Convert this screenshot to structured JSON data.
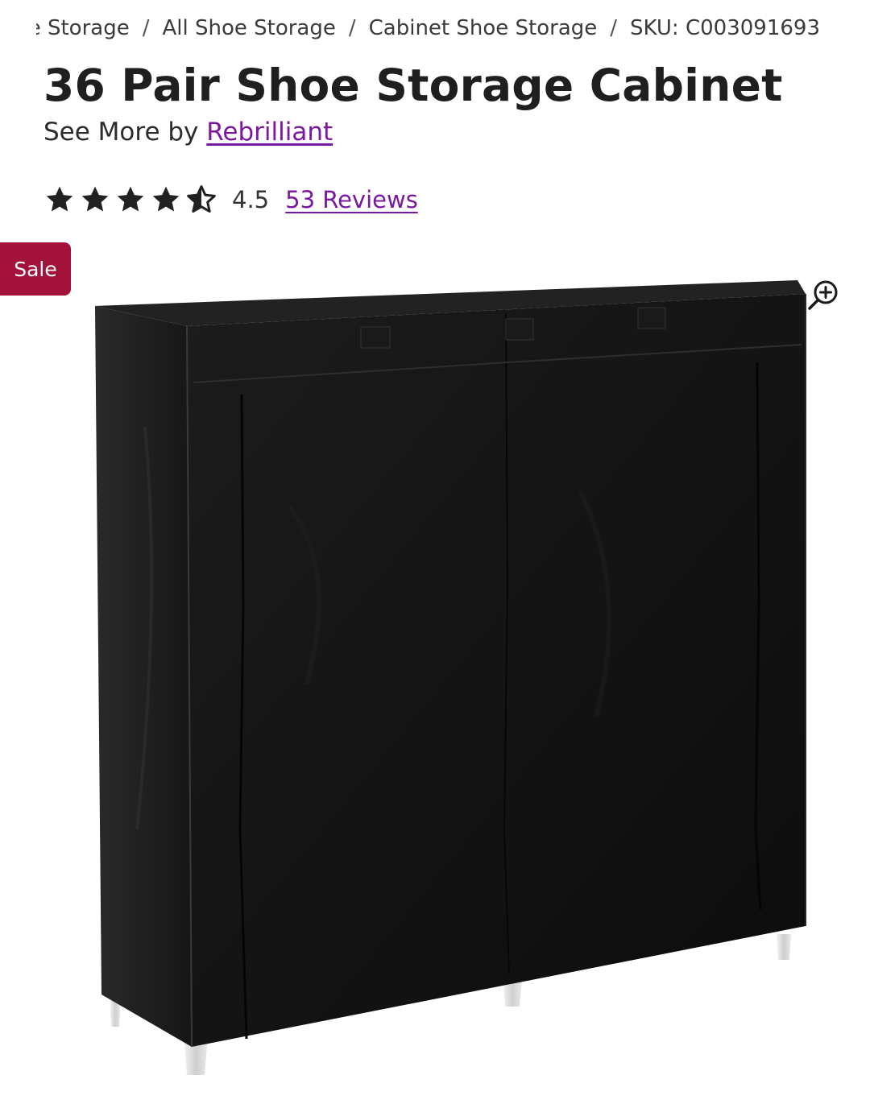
{
  "breadcrumb": {
    "items": [
      {
        "label": "Shoe Storage"
      },
      {
        "label": "All Shoe Storage"
      },
      {
        "label": "Cabinet Shoe Storage"
      }
    ],
    "separator": "/",
    "sku": "SKU: C003091693"
  },
  "product": {
    "title": "36 Pair Shoe Storage Cabinet",
    "see_more_prefix": "See More by",
    "brand": "Rebrilliant",
    "rating": 4.5,
    "rating_text": "4.5",
    "reviews_link": "53 Reviews",
    "sale_badge": "Sale",
    "image_icon": "shoe-cabinet-black-fabric"
  },
  "icons": {
    "star_full": "star-icon",
    "star_half": "half-star-icon",
    "zoom": "zoom-in-icon"
  },
  "colors": {
    "link": "#7b189f",
    "sale": "#a3123a",
    "text": "#1f1f1f",
    "star": "#222222"
  }
}
